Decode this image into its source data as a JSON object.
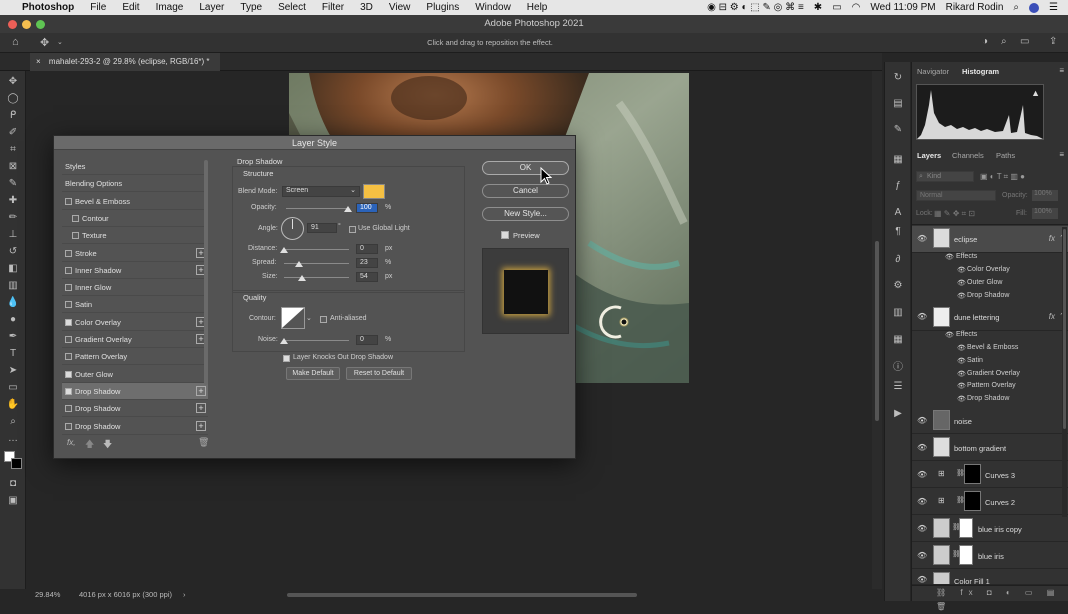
{
  "menubar": {
    "app": "Photoshop",
    "items": [
      "File",
      "Edit",
      "Image",
      "Layer",
      "Type",
      "Select",
      "Filter",
      "3D",
      "View",
      "Plugins",
      "Window",
      "Help"
    ],
    "clock": "Wed 11:09 PM",
    "user": "Rikard Rodin"
  },
  "window": {
    "title": "Adobe Photoshop 2021",
    "hint": "Click and drag to reposition the effect."
  },
  "document": {
    "tab_title": "mahalet-293-2 @ 29.8% (eclipse, RGB/16*) *",
    "zoom": "29.84%",
    "doc_info": "4016 px x 6016 px (300 ppi)"
  },
  "panels": {
    "top_tabs": [
      "Navigator",
      "Histogram"
    ],
    "layer_tabs": [
      "Layers",
      "Channels",
      "Paths"
    ],
    "search_placeholder": "Kind",
    "blend_mode": "Normal",
    "opacity_label": "Opacity:",
    "opacity_value": "100%",
    "lock_label": "Lock:",
    "fill_label": "Fill:",
    "fill_value": "100%",
    "layers": [
      {
        "name": "eclipse",
        "fx": "fx",
        "effects_label": "Effects",
        "effects": [
          "Color Overlay",
          "Outer Glow",
          "Drop Shadow"
        ]
      },
      {
        "name": "dune lettering",
        "fx": "fx",
        "effects_label": "Effects",
        "effects": [
          "Bevel & Emboss",
          "Satin",
          "Gradient Overlay",
          "Pattern Overlay",
          "Drop Shadow"
        ]
      },
      {
        "name": "noise"
      },
      {
        "name": "bottom gradient"
      },
      {
        "name": "Curves 3"
      },
      {
        "name": "Curves 2"
      },
      {
        "name": "blue iris copy"
      },
      {
        "name": "blue iris"
      },
      {
        "name": "Color Fill 1"
      }
    ]
  },
  "dialog": {
    "title": "Layer Style",
    "styles": [
      {
        "label": "Styles",
        "checkbox": false,
        "checked": false,
        "plus": false
      },
      {
        "label": "Blending Options",
        "checkbox": false,
        "checked": false,
        "plus": false
      },
      {
        "label": "Bevel & Emboss",
        "checkbox": true,
        "checked": false,
        "plus": false
      },
      {
        "label": "Contour",
        "checkbox": true,
        "checked": false,
        "plus": false,
        "indent": true
      },
      {
        "label": "Texture",
        "checkbox": true,
        "checked": false,
        "plus": false,
        "indent": true
      },
      {
        "label": "Stroke",
        "checkbox": true,
        "checked": false,
        "plus": true
      },
      {
        "label": "Inner Shadow",
        "checkbox": true,
        "checked": false,
        "plus": true
      },
      {
        "label": "Inner Glow",
        "checkbox": true,
        "checked": false,
        "plus": false
      },
      {
        "label": "Satin",
        "checkbox": true,
        "checked": false,
        "plus": false
      },
      {
        "label": "Color Overlay",
        "checkbox": true,
        "checked": true,
        "plus": true
      },
      {
        "label": "Gradient Overlay",
        "checkbox": true,
        "checked": false,
        "plus": true
      },
      {
        "label": "Pattern Overlay",
        "checkbox": true,
        "checked": false,
        "plus": false
      },
      {
        "label": "Outer Glow",
        "checkbox": true,
        "checked": true,
        "plus": false
      },
      {
        "label": "Drop Shadow",
        "checkbox": true,
        "checked": true,
        "plus": true,
        "selected": true
      },
      {
        "label": "Drop Shadow",
        "checkbox": true,
        "checked": false,
        "plus": true
      },
      {
        "label": "Drop Shadow",
        "checkbox": true,
        "checked": false,
        "plus": true
      }
    ],
    "section_title": "Drop Shadow",
    "structure": {
      "title": "Structure",
      "blend_mode_label": "Blend Mode:",
      "blend_mode": "Screen",
      "shadow_color": "#f5c043",
      "opacity_label": "Opacity:",
      "opacity": "100",
      "opacity_unit": "%",
      "angle_label": "Angle:",
      "angle": "91",
      "angle_unit": "°",
      "global_light_label": "Use Global Light",
      "distance_label": "Distance:",
      "distance": "0",
      "distance_unit": "px",
      "spread_label": "Spread:",
      "spread": "23",
      "spread_unit": "%",
      "size_label": "Size:",
      "size": "54",
      "size_unit": "px"
    },
    "quality": {
      "title": "Quality",
      "contour_label": "Contour:",
      "anti_aliased_label": "Anti-aliased",
      "noise_label": "Noise:",
      "noise": "0",
      "noise_unit": "%"
    },
    "knocks_out_label": "Layer Knocks Out Drop Shadow",
    "make_default": "Make Default",
    "reset_default": "Reset to Default",
    "ok": "OK",
    "cancel": "Cancel",
    "new_style": "New Style...",
    "preview_label": "Preview",
    "fx_label": "fx,"
  }
}
